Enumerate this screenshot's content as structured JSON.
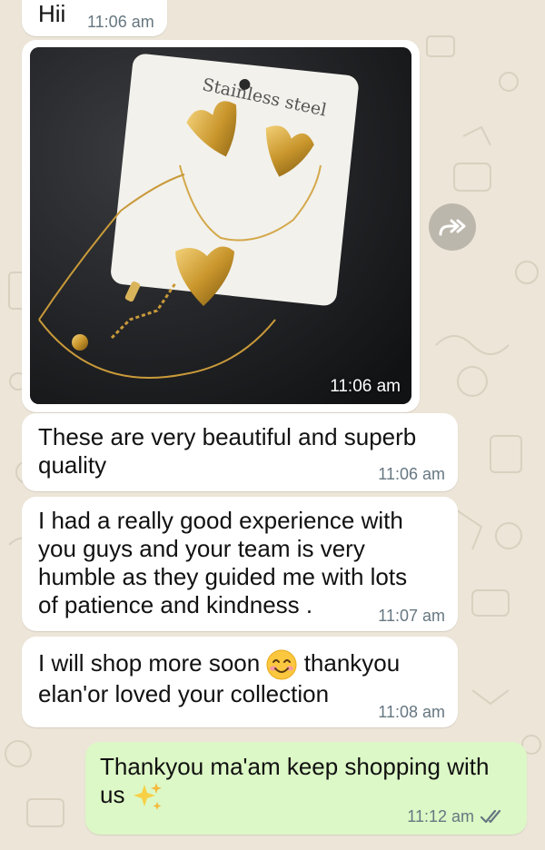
{
  "messages": [
    {
      "text": "Hii",
      "time": "11:06 am"
    },
    {
      "image_time": "11:06 am",
      "card_text": "Stainless steel"
    },
    {
      "text": "These are very beautiful and superb quality",
      "time": "11:06 am"
    },
    {
      "text": "I had a really good experience with you guys and your team is very humble as they guided me with lots of patience and kindness .",
      "time": "11:07 am"
    },
    {
      "text_before": "I will shop more soon",
      "emoji": "smiling-face-emoji",
      "text_after": "thankyou elan'or loved your collection",
      "time": "11:08 am"
    },
    {
      "text": "Thankyou ma'am keep shopping with us",
      "emoji": "sparkles-emoji",
      "time": "11:12 am",
      "status": "read"
    }
  ],
  "icons": {
    "forward": "forward-icon",
    "read_receipt": "double-check-icon"
  },
  "colors": {
    "chat_background": "#ece5d8",
    "incoming_bubble": "#ffffff",
    "outgoing_bubble": "#dcf8c6",
    "timestamp": "#667781"
  }
}
